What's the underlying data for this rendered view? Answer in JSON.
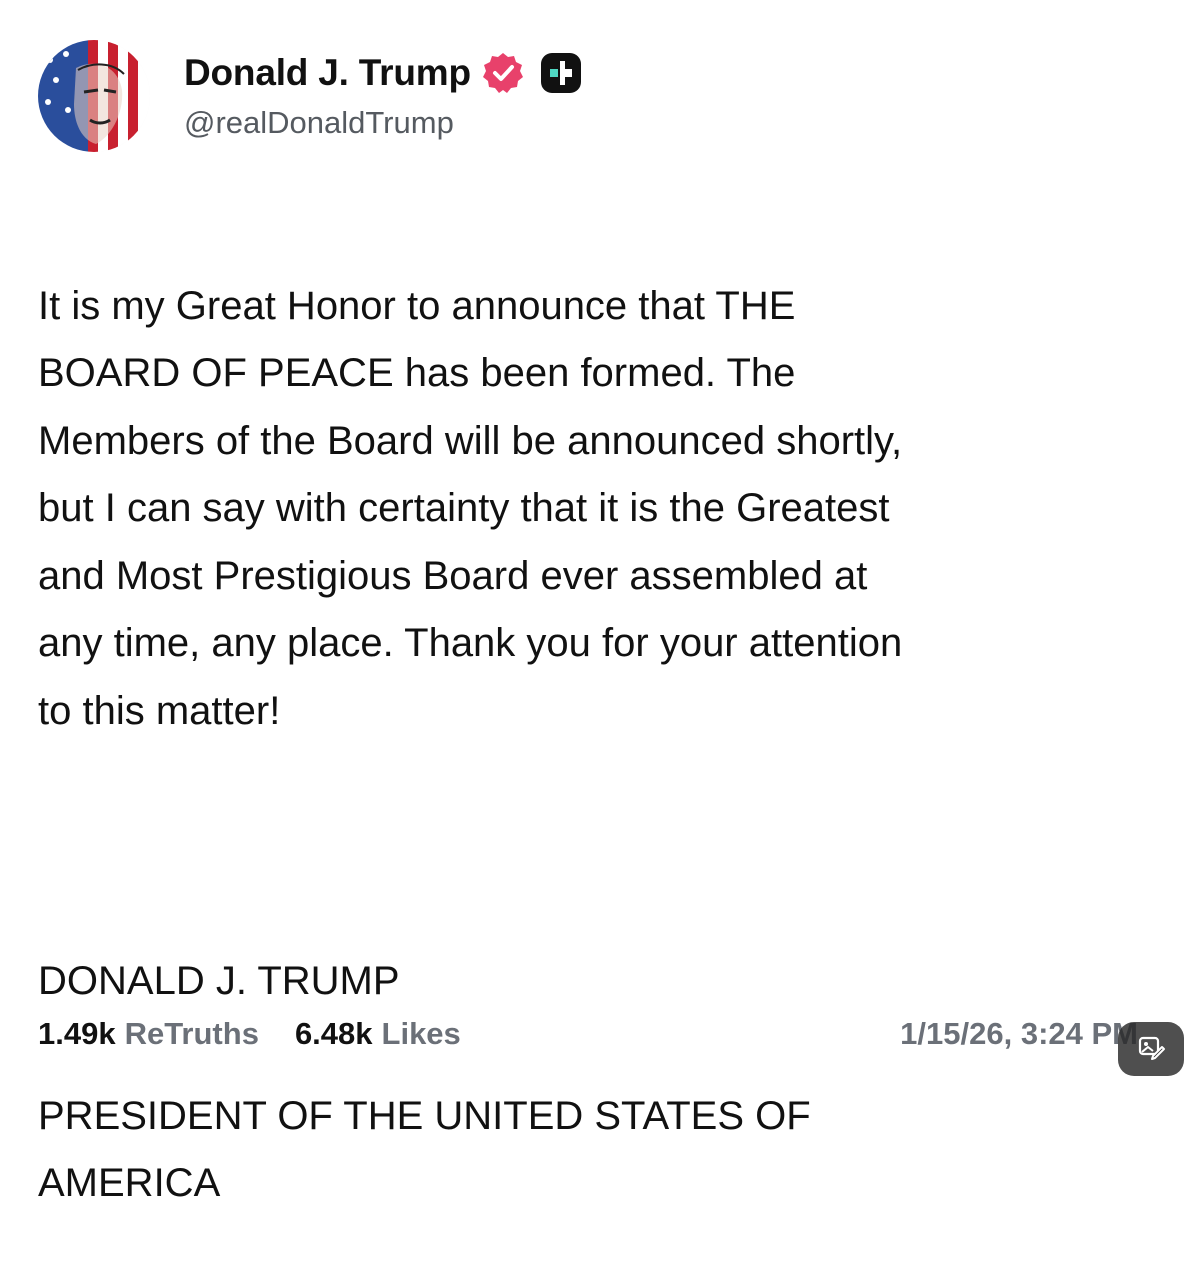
{
  "post": {
    "author": {
      "display_name": "Donald J. Trump",
      "handle": "@realDonaldTrump",
      "verified_icon": "verified-check-icon",
      "badge_icon": "truth-plus-icon",
      "verified_color": "#e8416b"
    },
    "body_paragraph": "It is my Great Honor to announce that THE\nBOARD OF PEACE has been formed. The\nMembers of the Board will be announced shortly,\nbut I can say with certainty that it is the Greatest\nand Most Prestigious Board ever assembled at\nany time, any place. Thank you for your attention\nto this matter!",
    "signature_name": "DONALD J. TRUMP",
    "signature_title": "PRESIDENT OF THE UNITED STATES OF\nAMERICA",
    "stats": {
      "retruths_count": "1.49k",
      "retruths_label": "ReTruths",
      "likes_count": "6.48k",
      "likes_label": "Likes"
    },
    "timestamp": "1/15/26, 3:24 PM"
  },
  "overlay": {
    "action_icon": "image-edit-icon"
  }
}
